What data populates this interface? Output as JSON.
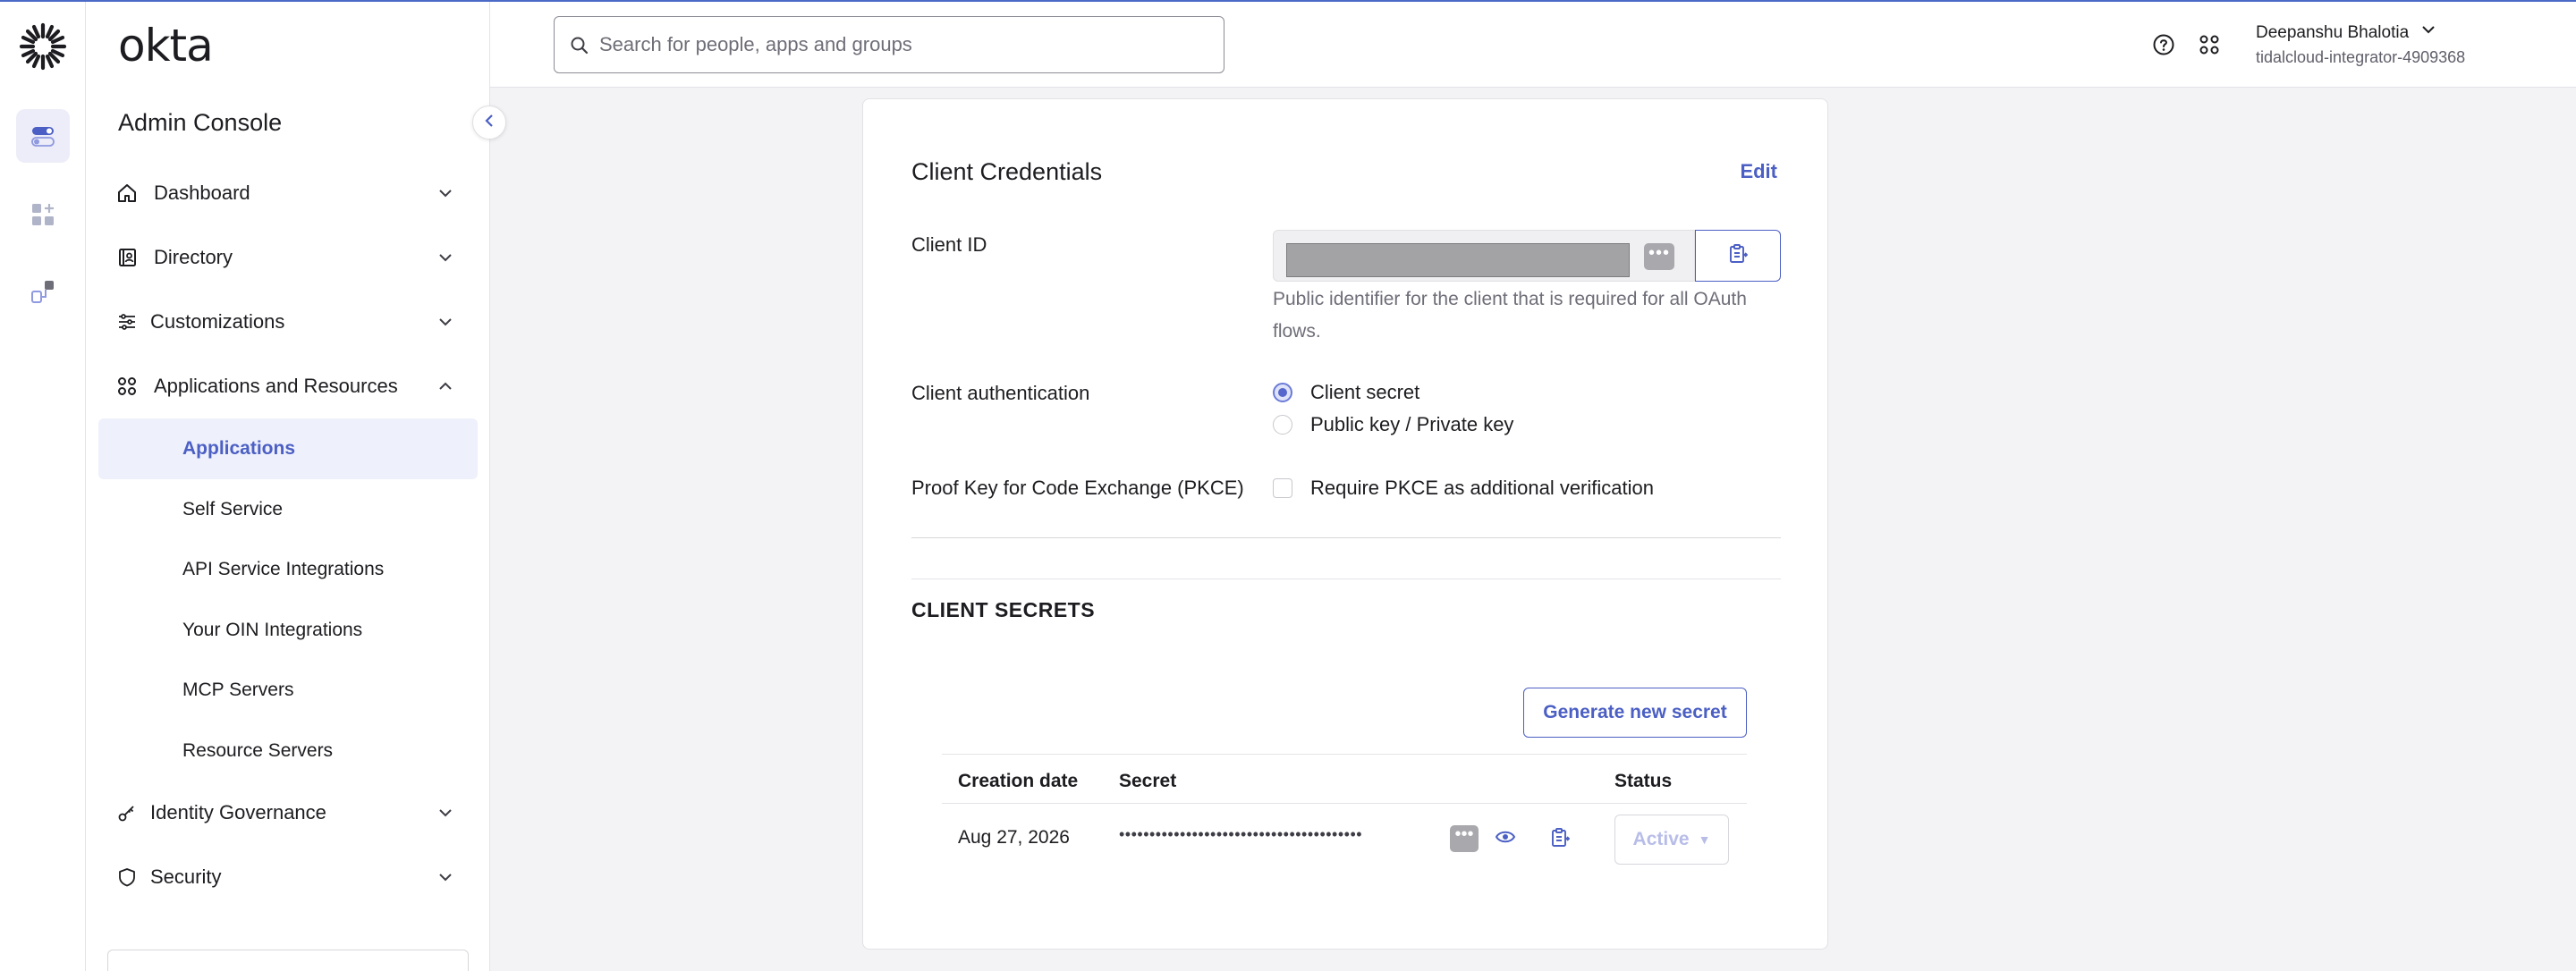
{
  "brand": {
    "wordmark": "okta",
    "accent": "#4b5fc4"
  },
  "sidebar": {
    "title": "Admin Console",
    "items": [
      {
        "label": "Dashboard",
        "icon": "home-icon",
        "expanded": false
      },
      {
        "label": "Directory",
        "icon": "directory-icon",
        "expanded": false
      },
      {
        "label": "Customizations",
        "icon": "sliders-icon",
        "expanded": false
      },
      {
        "label": "Applications and Resources",
        "icon": "apps-grid-icon",
        "expanded": true,
        "children": [
          {
            "label": "Applications",
            "active": true
          },
          {
            "label": "Self Service"
          },
          {
            "label": "API Service Integrations"
          },
          {
            "label": "Your OIN Integrations"
          },
          {
            "label": "MCP Servers"
          },
          {
            "label": "Resource Servers"
          }
        ]
      },
      {
        "label": "Identity Governance",
        "icon": "key-icon",
        "expanded": false
      },
      {
        "label": "Security",
        "icon": "shield-icon",
        "expanded": false
      }
    ]
  },
  "header": {
    "search_placeholder": "Search for people, apps and groups",
    "search_value": "",
    "user_name": "Deepanshu Bhalotia",
    "org": "tidalcloud-integrator-4909368"
  },
  "card": {
    "title": "Client Credentials",
    "edit_label": "Edit",
    "client_id_label": "Client ID",
    "client_id_help": "Public identifier for the client that is required for all OAuth flows.",
    "client_auth_label": "Client authentication",
    "auth_options": [
      {
        "label": "Client secret",
        "checked": true
      },
      {
        "label": "Public key / Private key",
        "checked": false
      }
    ],
    "pkce_label": "Proof Key for Code Exchange (PKCE)",
    "pkce_option": "Require PKCE as additional verification",
    "pkce_checked": false
  },
  "secrets": {
    "title": "CLIENT SECRETS",
    "generate_label": "Generate new secret",
    "columns": [
      "Creation date",
      "Secret",
      "Status"
    ],
    "rows": [
      {
        "created": "Aug 27, 2026",
        "secret": "••••••••••••••••••••••••••••••••••••••••",
        "status": "Active"
      }
    ]
  }
}
